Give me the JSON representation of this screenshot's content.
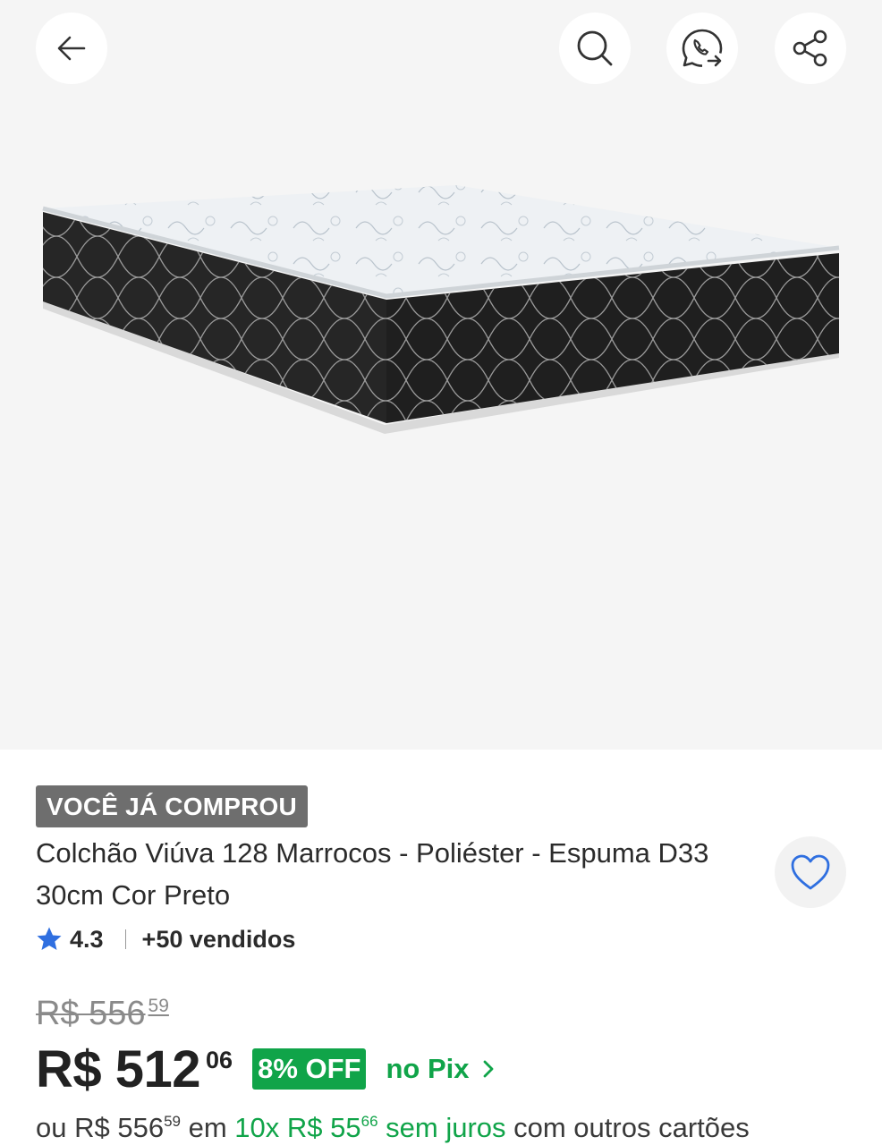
{
  "header": {
    "back_icon": "arrow-left-icon",
    "search_icon": "search-icon",
    "whatsapp_icon": "whatsapp-icon",
    "share_icon": "share-icon"
  },
  "product": {
    "image_alt": "mattress",
    "badge": "VOCÊ JÁ COMPROU",
    "title": "Colchão Viúva 128 Marrocos - Poliéster - Espuma D33 30cm Cor Preto",
    "favorite_icon": "heart-icon",
    "rating": "4.3",
    "sold": "+50 vendidos"
  },
  "pricing": {
    "old_price_main": "R$ 556",
    "old_price_cents": "59",
    "price_main": "R$ 512",
    "price_cents": "06",
    "discount": "8% OFF",
    "pix_label": "no Pix",
    "installment_prefix": "ou R$ 556",
    "installment_prefix_cents": "59",
    "installment_em": " em ",
    "installment_count": "10x R$ 55",
    "installment_cents": "66",
    "installment_no_interest": " sem juros",
    "installment_suffix": " com outros cartões"
  },
  "colors": {
    "accent_green": "#10a449",
    "star_blue": "#2f6fe0",
    "badge_gray": "#6e6e6e"
  }
}
